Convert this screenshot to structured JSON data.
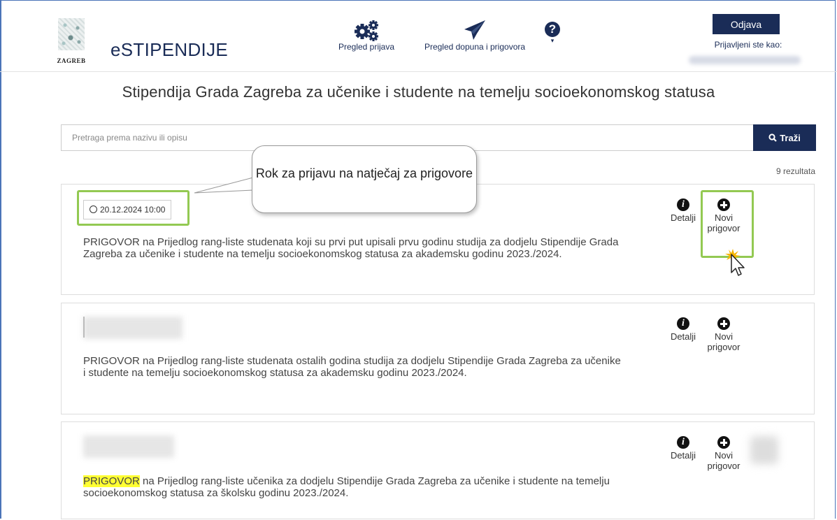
{
  "app": {
    "logo_text": "ZAGREB",
    "title": "eSTIPENDIJE"
  },
  "nav": {
    "overview": {
      "label": "Pregled prijava",
      "icon": "gears-icon"
    },
    "supplements": {
      "label": "Pregled dopuna i prigovora",
      "icon": "paper-plane-icon"
    },
    "help": {
      "icon": "question-circle-icon",
      "glyph": "?",
      "caret": "▾"
    }
  },
  "user": {
    "logout_label": "Odjava",
    "logged_in_label": "Prijavljeni ste kao:"
  },
  "page": {
    "title": "Stipendija Grada Zagreba za učenike i studente na temelju socioekonomskog statusa"
  },
  "search": {
    "placeholder": "Pretraga prema nazivu ili opisu",
    "button_label": "Traži"
  },
  "results": {
    "count_label": "9 rezultata"
  },
  "callout": {
    "text": "Rok za prijavu na natječaj za prigovore"
  },
  "cards": [
    {
      "deadline": "20.12.2024 10:00",
      "description": "PRIGOVOR na Prijedlog rang-liste studenata koji su prvi put upisali prvu godinu studija za dodjelu Stipendije Grada Zagreba za učenike i studente na temelju socioekonomskog statusa za akademsku godinu 2023./2024.",
      "details_label": "Detalji",
      "new_objection_label": "Novi prigovor"
    },
    {
      "description": "PRIGOVOR na Prijedlog rang-liste studenata ostalih godina studija za dodjelu Stipendije Grada Zagreba za učenike i studente na temelju socioekonomskog statusa za akademsku godinu 2023./2024.",
      "details_label": "Detalji",
      "new_objection_label": "Novi prigovor"
    },
    {
      "description_highlight": "PRIGOVOR",
      "description_rest": " na Prijedlog rang-liste učenika za dodjelu Stipendije Grada Zagreba za učenike i studente na temelju socioekonomskog statusa za školsku godinu 2023./2024.",
      "details_label": "Detalji",
      "new_objection_label": "Novi prigovor"
    }
  ],
  "colors": {
    "brand_navy": "#1a2c57",
    "highlight_green": "#93c952",
    "highlight_yellow": "#ffff33"
  }
}
